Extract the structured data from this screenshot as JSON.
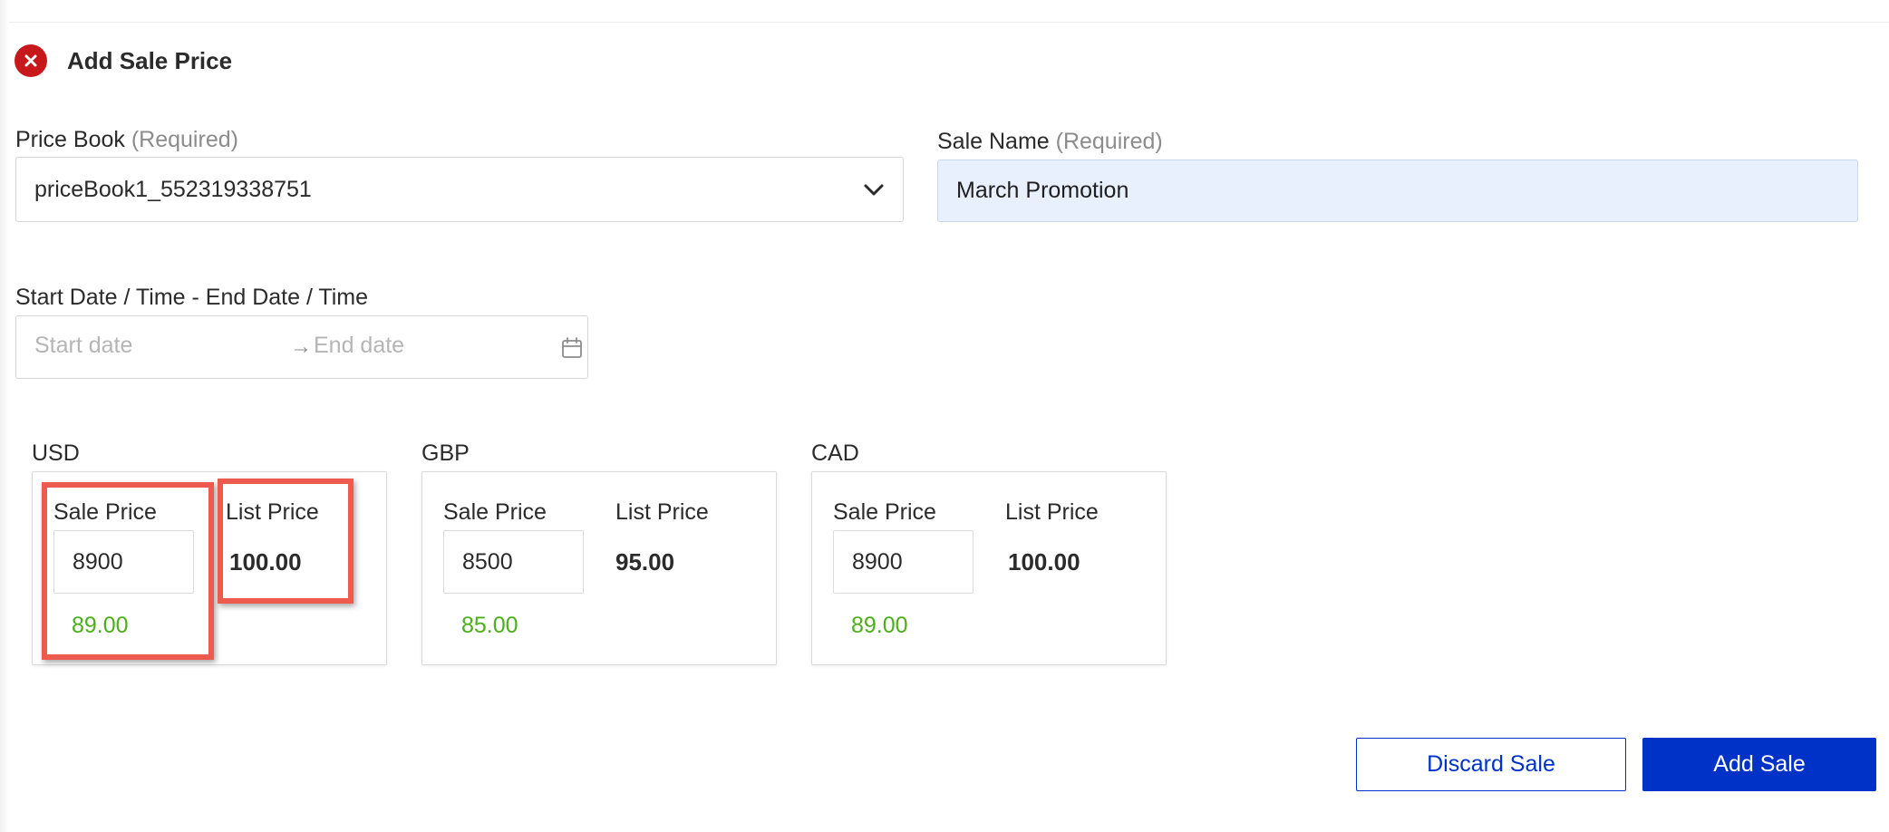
{
  "header": {
    "title": "Add Sale Price",
    "close_icon": "close-icon"
  },
  "form": {
    "price_book": {
      "label": "Price Book",
      "required": "(Required)",
      "value": "priceBook1_552319338751"
    },
    "sale_name": {
      "label": "Sale Name",
      "required": "(Required)",
      "value": "March Promotion"
    },
    "date_range": {
      "label": "Start Date / Time - End Date / Time",
      "start_placeholder": "Start date",
      "separator": "→",
      "end_placeholder": "End date"
    }
  },
  "prices": {
    "sale_price_label": "Sale Price",
    "list_price_label": "List Price",
    "currencies": [
      {
        "code": "USD",
        "sale_input": "8900",
        "sale_computed": "89.00",
        "list_price": "100.00"
      },
      {
        "code": "GBP",
        "sale_input": "8500",
        "sale_computed": "85.00",
        "list_price": "95.00"
      },
      {
        "code": "CAD",
        "sale_input": "8900",
        "sale_computed": "89.00",
        "list_price": "100.00"
      }
    ]
  },
  "actions": {
    "discard_label": "Discard Sale",
    "add_label": "Add Sale"
  },
  "colors": {
    "primary": "#0032c8",
    "danger": "#c7191c",
    "success": "#4caf1a",
    "highlight": "#ee5b4e",
    "autofill": "#e8f0fe"
  }
}
